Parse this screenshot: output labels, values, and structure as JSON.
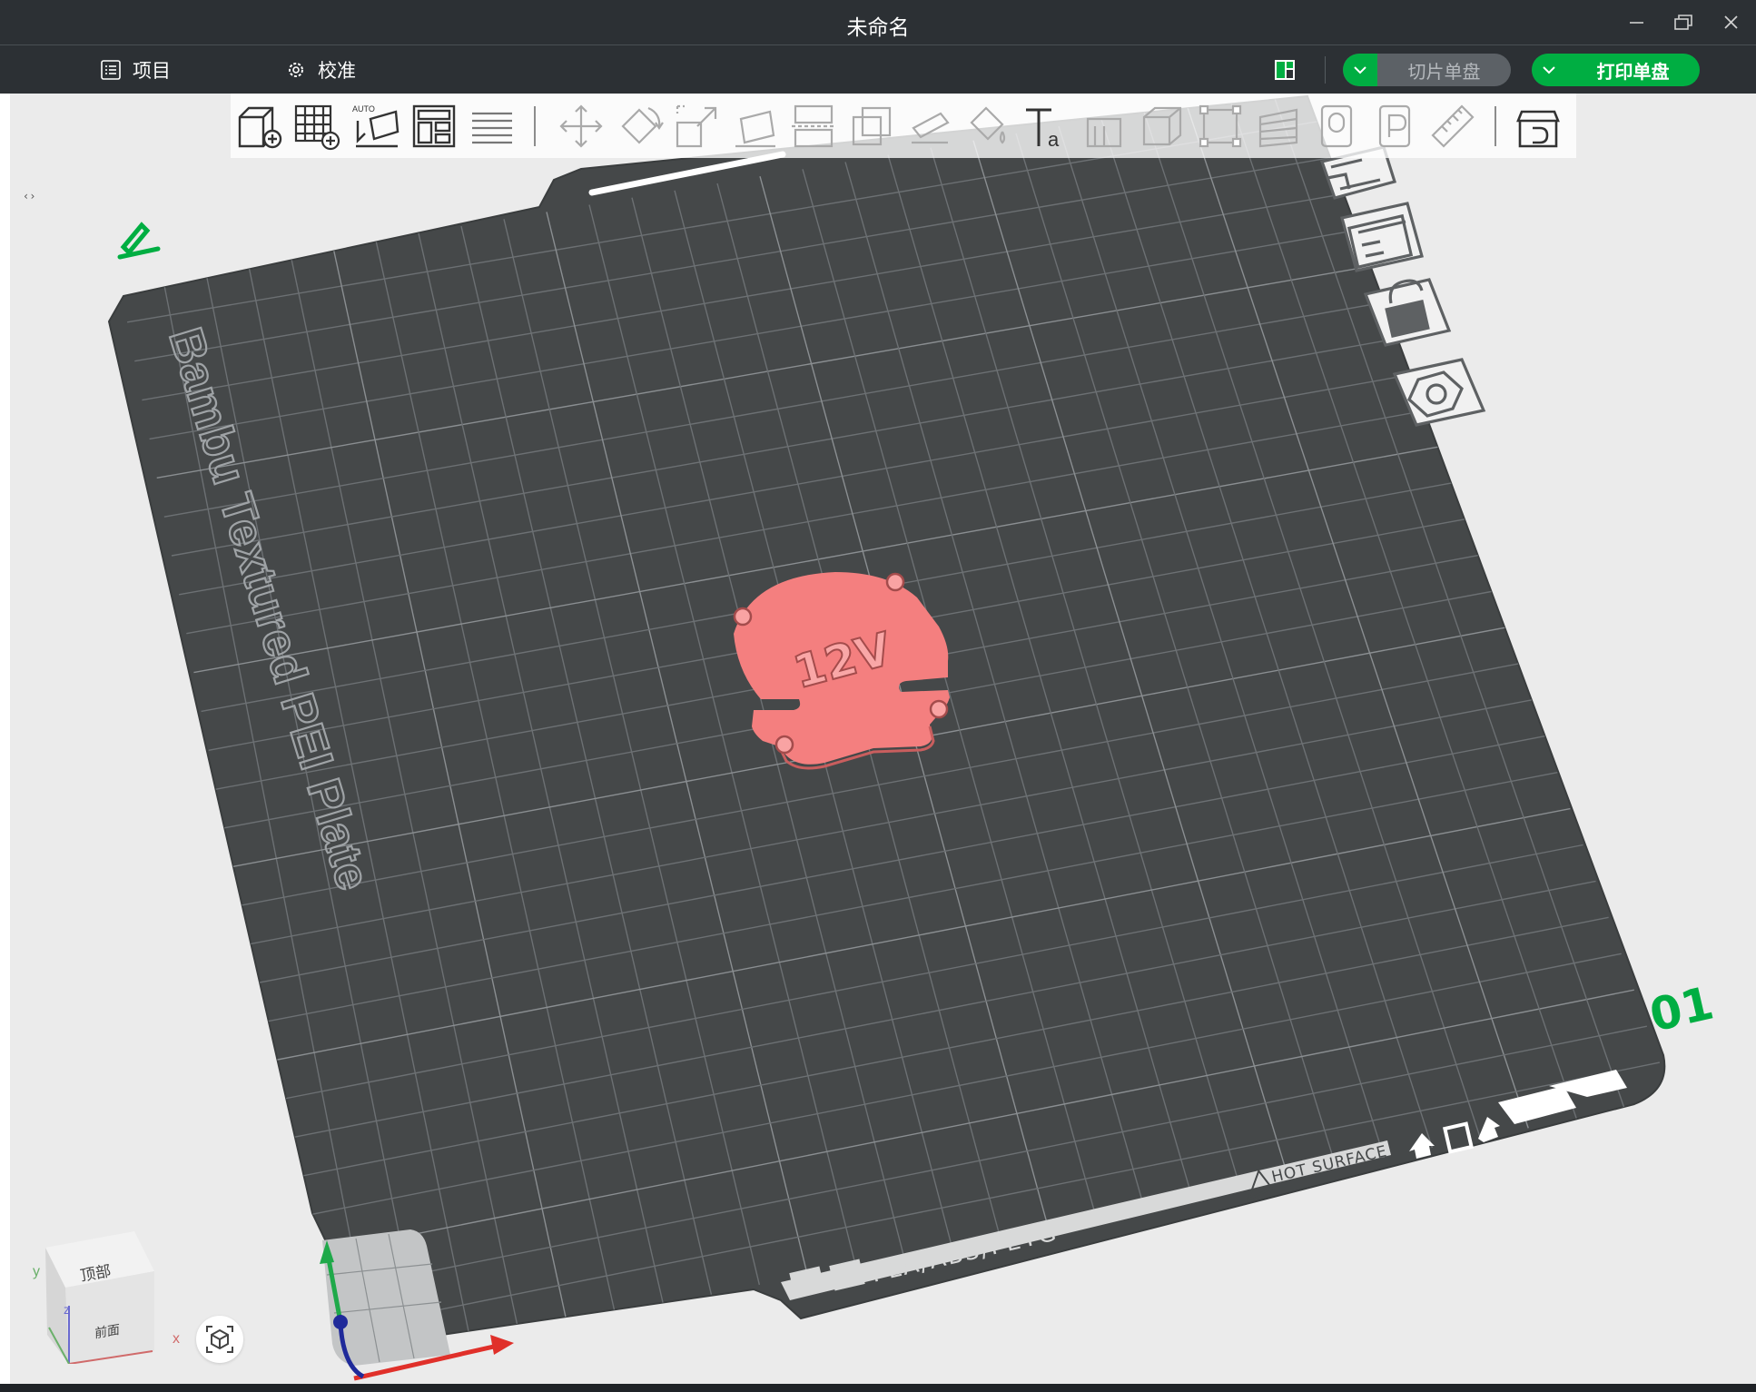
{
  "window": {
    "title": "未命名",
    "controls": [
      "minimize",
      "restore",
      "close"
    ]
  },
  "menubar": {
    "project_label": "项目",
    "calibration_label": "校准",
    "slice_button_label": "切片单盘",
    "print_button_label": "打印单盘"
  },
  "viewport": {
    "collapse_toggle": "‹›",
    "plate_name": "Bambu Textured PEI Plate",
    "plate_number": "01",
    "plate_material": "PLA/ABS/PETG",
    "plate_warning": "HOT SURFACE",
    "model_label": "12V",
    "model_color": "#f47f7f",
    "accent_color": "#00ae42"
  },
  "navcube": {
    "top_label": "顶部",
    "front_label": "前面",
    "axis_x": "x",
    "axis_y": "y",
    "axis_z": "z"
  },
  "toolbar": {
    "tools": [
      "add-object-icon",
      "add-plate-icon",
      "auto-orient-icon",
      "arrange-icon",
      "layers-icon",
      "move-icon",
      "rotate-icon",
      "scale-icon",
      "lay-on-face-icon",
      "cut-icon",
      "boolean-icon",
      "paint-support-icon",
      "paint-color-icon",
      "text-icon",
      "assembly-icon",
      "emboss-icon",
      "measure-box-icon",
      "variable-layer-icon",
      "mesh-boolean-icon",
      "seam-paint-icon",
      "ruler-icon",
      "assembly-view-icon"
    ]
  }
}
